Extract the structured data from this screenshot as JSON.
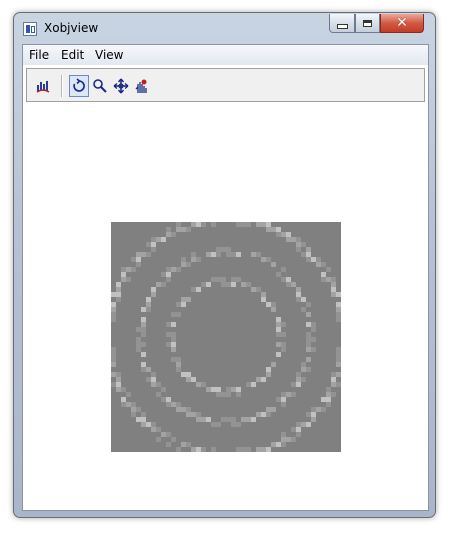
{
  "window": {
    "title": "Xobjview",
    "app_icon": "xobjview-app-icon",
    "controls": {
      "minimize_icon": "minimize-icon",
      "maximize_icon": "maximize-icon",
      "close_icon": "close-icon",
      "close_glyph": "✕"
    }
  },
  "menubar": {
    "items": [
      {
        "label": "File"
      },
      {
        "label": "Edit"
      },
      {
        "label": "View"
      }
    ]
  },
  "toolbar": {
    "buttons": [
      {
        "icon": "signal-icon",
        "pressed": false
      },
      {
        "icon": "rotate-icon",
        "pressed": true
      },
      {
        "icon": "zoom-icon",
        "pressed": false
      },
      {
        "icon": "pan-icon",
        "pressed": false
      },
      {
        "icon": "probe-icon",
        "pressed": false
      }
    ]
  },
  "canvas": {
    "background_color": "#808080",
    "ring_color": "#a6a6a6",
    "highlight_color": "#c8c8c8",
    "content": "grayscale-image-with-concentric-rings"
  }
}
